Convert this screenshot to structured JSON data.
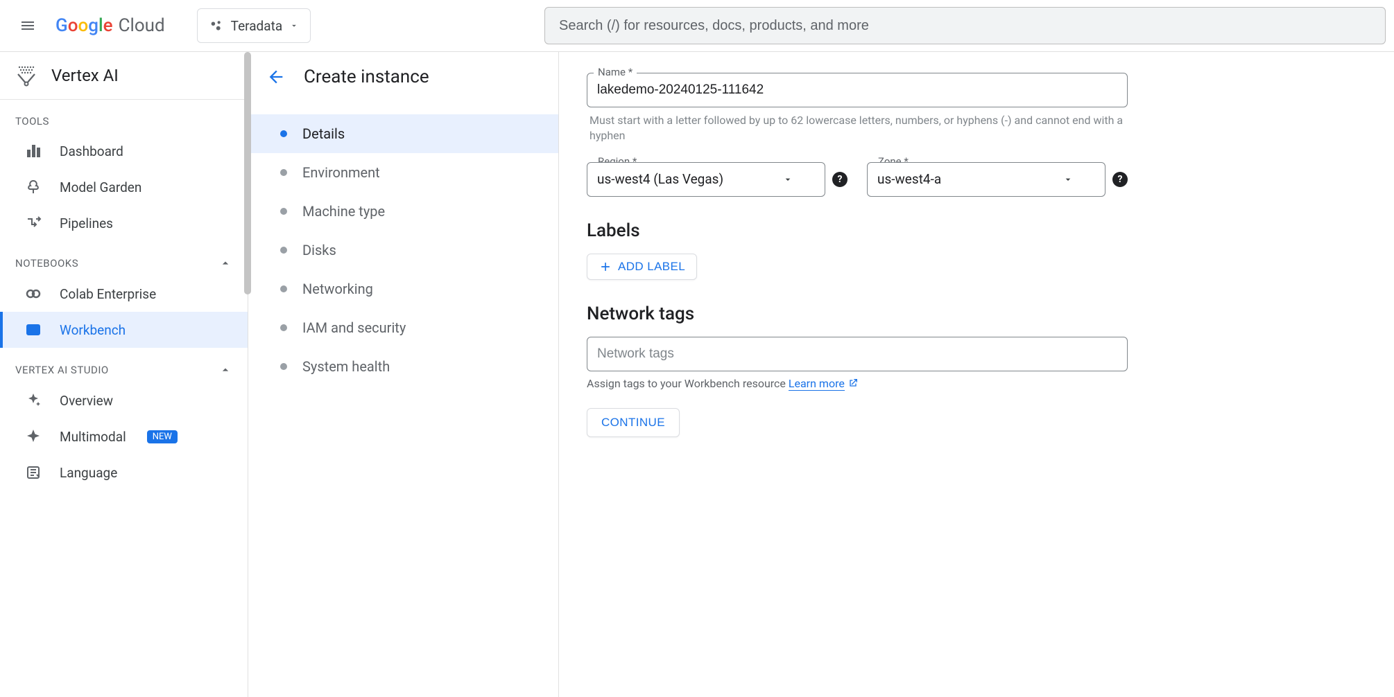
{
  "header": {
    "brand_cloud": "Cloud",
    "project_name": "Teradata",
    "search_placeholder": "Search (/) for resources, docs, products, and more"
  },
  "leftnav": {
    "product_name": "Vertex AI",
    "sections": {
      "tools_title": "TOOLS",
      "tools": [
        {
          "label": "Dashboard"
        },
        {
          "label": "Model Garden"
        },
        {
          "label": "Pipelines"
        }
      ],
      "notebooks_title": "NOTEBOOKS",
      "notebooks": [
        {
          "label": "Colab Enterprise"
        },
        {
          "label": "Workbench"
        }
      ],
      "studio_title": "VERTEX AI STUDIO",
      "studio": [
        {
          "label": "Overview"
        },
        {
          "label": "Multimodal",
          "badge": "NEW"
        },
        {
          "label": "Language"
        }
      ]
    }
  },
  "page": {
    "title": "Create instance",
    "steps": [
      "Details",
      "Environment",
      "Machine type",
      "Disks",
      "Networking",
      "IAM and security",
      "System health"
    ]
  },
  "form": {
    "name_label": "Name *",
    "name_value": "lakedemo-20240125-111642",
    "name_helper": "Must start with a letter followed by up to 62 lowercase letters, numbers, or hyphens (-) and cannot end with a hyphen",
    "region_label": "Region *",
    "region_value": "us-west4 (Las Vegas)",
    "zone_label": "Zone *",
    "zone_value": "us-west4-a",
    "labels_heading": "Labels",
    "add_label_btn": "ADD LABEL",
    "tags_heading": "Network tags",
    "tags_placeholder": "Network tags",
    "tags_helper_prefix": "Assign tags to your Workbench resource ",
    "tags_learn_more": "Learn more",
    "continue_btn": "CONTINUE"
  }
}
